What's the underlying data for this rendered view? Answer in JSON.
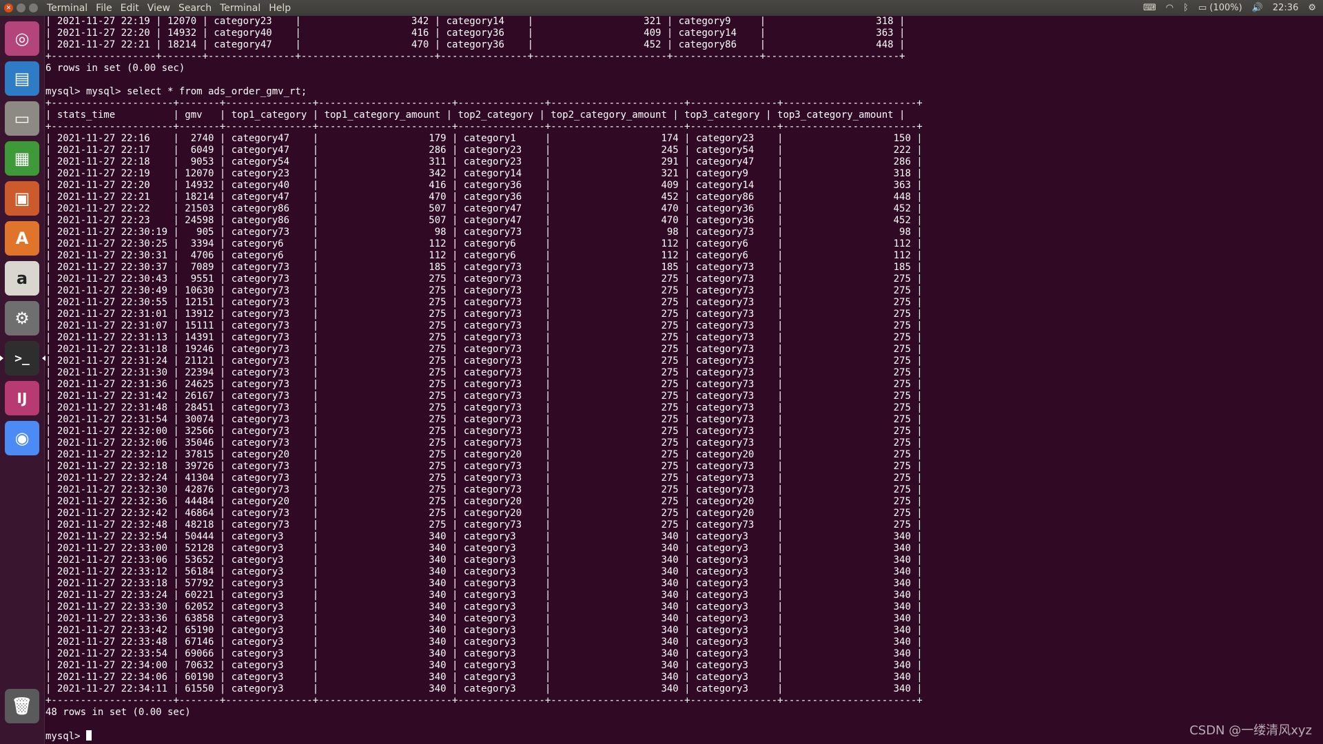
{
  "menubar": {
    "app_name": "Terminal",
    "items": [
      "File",
      "Edit",
      "View",
      "Search",
      "Terminal",
      "Help"
    ],
    "battery": "(100%)",
    "clock": "22:36"
  },
  "launcher": {
    "items": [
      {
        "name": "ubuntu-dash-icon",
        "glyph": "◎",
        "bg": "#b3457a"
      },
      {
        "name": "libreoffice-writer-icon",
        "glyph": "▤",
        "bg": "#2f7cc6"
      },
      {
        "name": "files-icon",
        "glyph": "▭",
        "bg": "#8d8a83"
      },
      {
        "name": "libreoffice-calc-icon",
        "glyph": "▦",
        "bg": "#3e9a38"
      },
      {
        "name": "libreoffice-impress-icon",
        "glyph": "▣",
        "bg": "#cc5a2a"
      },
      {
        "name": "software-center-icon",
        "glyph": "A",
        "bg": "#e0742a"
      },
      {
        "name": "amazon-icon",
        "glyph": "a",
        "bg": "#d9d6d0"
      },
      {
        "name": "system-settings-icon",
        "glyph": "⚙",
        "bg": "#6f6f6f"
      },
      {
        "name": "terminal-icon",
        "glyph": ">_",
        "bg": "#2e2e2e"
      },
      {
        "name": "intellij-idea-icon",
        "glyph": "IJ",
        "bg": "#b83a72"
      },
      {
        "name": "chrome-icon",
        "glyph": "◉",
        "bg": "#4c8bf5"
      },
      {
        "name": "trash-icon",
        "glyph": "🗑",
        "bg": "#5a5a5a"
      }
    ]
  },
  "terminal": {
    "lines": [
      "| 2021-11-27 22:19 | 12070 | category23    |                   342 | category14    |                   321 | category9     |                   318 |",
      "| 2021-11-27 22:20 | 14932 | category40    |                   416 | category36    |                   409 | category14    |                   363 |",
      "| 2021-11-27 22:21 | 18214 | category47    |                   470 | category36    |                   452 | category86    |                   448 |",
      "+------------------+-------+---------------+-----------------------+---------------+-----------------------+---------------+-----------------------+",
      "6 rows in set (0.00 sec)",
      "",
      "mysql> mysql> select * from ads_order_gmv_rt;",
      "+---------------------+-------+---------------+-----------------------+---------------+-----------------------+---------------+-----------------------+",
      "| stats_time          | gmv   | top1_category | top1_category_amount | top2_category | top2_category_amount | top3_category | top3_category_amount |",
      "+---------------------+-------+---------------+-----------------------+---------------+-----------------------+---------------+-----------------------+",
      "| 2021-11-27 22:16    |  2740 | category47    |                   179 | category1     |                   174 | category23    |                   150 |",
      "| 2021-11-27 22:17    |  6049 | category47    |                   286 | category23    |                   245 | category54    |                   222 |",
      "| 2021-11-27 22:18    |  9053 | category54    |                   311 | category23    |                   291 | category47    |                   286 |",
      "| 2021-11-27 22:19    | 12070 | category23    |                   342 | category14    |                   321 | category9     |                   318 |",
      "| 2021-11-27 22:20    | 14932 | category40    |                   416 | category36    |                   409 | category14    |                   363 |",
      "| 2021-11-27 22:21    | 18214 | category47    |                   470 | category36    |                   452 | category86    |                   448 |",
      "| 2021-11-27 22:22    | 21503 | category86    |                   507 | category47    |                   470 | category36    |                   452 |",
      "| 2021-11-27 22:23    | 24598 | category86    |                   507 | category47    |                   470 | category36    |                   452 |",
      "| 2021-11-27 22:30:19 |   905 | category73    |                    98 | category73    |                    98 | category73    |                    98 |",
      "| 2021-11-27 22:30:25 |  3394 | category6     |                   112 | category6     |                   112 | category6     |                   112 |",
      "| 2021-11-27 22:30:31 |  4706 | category6     |                   112 | category6     |                   112 | category6     |                   112 |",
      "| 2021-11-27 22:30:37 |  7089 | category73    |                   185 | category73    |                   185 | category73    |                   185 |",
      "| 2021-11-27 22:30:43 |  9551 | category73    |                   275 | category73    |                   275 | category73    |                   275 |",
      "| 2021-11-27 22:30:49 | 10630 | category73    |                   275 | category73    |                   275 | category73    |                   275 |",
      "| 2021-11-27 22:30:55 | 12151 | category73    |                   275 | category73    |                   275 | category73    |                   275 |",
      "| 2021-11-27 22:31:01 | 13912 | category73    |                   275 | category73    |                   275 | category73    |                   275 |",
      "| 2021-11-27 22:31:07 | 15111 | category73    |                   275 | category73    |                   275 | category73    |                   275 |",
      "| 2021-11-27 22:31:13 | 14391 | category73    |                   275 | category73    |                   275 | category73    |                   275 |",
      "| 2021-11-27 22:31:18 | 19246 | category73    |                   275 | category73    |                   275 | category73    |                   275 |",
      "| 2021-11-27 22:31:24 | 21121 | category73    |                   275 | category73    |                   275 | category73    |                   275 |",
      "| 2021-11-27 22:31:30 | 22394 | category73    |                   275 | category73    |                   275 | category73    |                   275 |",
      "| 2021-11-27 22:31:36 | 24625 | category73    |                   275 | category73    |                   275 | category73    |                   275 |",
      "| 2021-11-27 22:31:42 | 26167 | category73    |                   275 | category73    |                   275 | category73    |                   275 |",
      "| 2021-11-27 22:31:48 | 28451 | category73    |                   275 | category73    |                   275 | category73    |                   275 |",
      "| 2021-11-27 22:31:54 | 30074 | category73    |                   275 | category73    |                   275 | category73    |                   275 |",
      "| 2021-11-27 22:32:00 | 32566 | category73    |                   275 | category73    |                   275 | category73    |                   275 |",
      "| 2021-11-27 22:32:06 | 35046 | category73    |                   275 | category73    |                   275 | category73    |                   275 |",
      "| 2021-11-27 22:32:12 | 37815 | category20    |                   275 | category20    |                   275 | category20    |                   275 |",
      "| 2021-11-27 22:32:18 | 39726 | category73    |                   275 | category73    |                   275 | category73    |                   275 |",
      "| 2021-11-27 22:32:24 | 41304 | category73    |                   275 | category73    |                   275 | category73    |                   275 |",
      "| 2021-11-27 22:32:30 | 42876 | category73    |                   275 | category73    |                   275 | category73    |                   275 |",
      "| 2021-11-27 22:32:36 | 44484 | category20    |                   275 | category20    |                   275 | category20    |                   275 |",
      "| 2021-11-27 22:32:42 | 46864 | category73    |                   275 | category20    |                   275 | category20    |                   275 |",
      "| 2021-11-27 22:32:48 | 48218 | category73    |                   275 | category73    |                   275 | category73    |                   275 |",
      "| 2021-11-27 22:32:54 | 50444 | category3     |                   340 | category3     |                   340 | category3     |                   340 |",
      "| 2021-11-27 22:33:00 | 52128 | category3     |                   340 | category3     |                   340 | category3     |                   340 |",
      "| 2021-11-27 22:33:06 | 53652 | category3     |                   340 | category3     |                   340 | category3     |                   340 |",
      "| 2021-11-27 22:33:12 | 56184 | category3     |                   340 | category3     |                   340 | category3     |                   340 |",
      "| 2021-11-27 22:33:18 | 57792 | category3     |                   340 | category3     |                   340 | category3     |                   340 |",
      "| 2021-11-27 22:33:24 | 60221 | category3     |                   340 | category3     |                   340 | category3     |                   340 |",
      "| 2021-11-27 22:33:30 | 62052 | category3     |                   340 | category3     |                   340 | category3     |                   340 |",
      "| 2021-11-27 22:33:36 | 63858 | category3     |                   340 | category3     |                   340 | category3     |                   340 |",
      "| 2021-11-27 22:33:42 | 65190 | category3     |                   340 | category3     |                   340 | category3     |                   340 |",
      "| 2021-11-27 22:33:48 | 67146 | category3     |                   340 | category3     |                   340 | category3     |                   340 |",
      "| 2021-11-27 22:33:54 | 69066 | category3     |                   340 | category3     |                   340 | category3     |                   340 |",
      "| 2021-11-27 22:34:00 | 70632 | category3     |                   340 | category3     |                   340 | category3     |                   340 |",
      "| 2021-11-27 22:34:06 | 60190 | category3     |                   340 | category3     |                   340 | category3     |                   340 |",
      "| 2021-11-27 22:34:11 | 61550 | category3     |                   340 | category3     |                   340 | category3     |                   340 |",
      "+---------------------+-------+---------------+-----------------------+---------------+-----------------------+---------------+-----------------------+",
      "48 rows in set (0.00 sec)",
      "",
      "mysql> "
    ]
  },
  "watermark": "CSDN @一缕清风xyz"
}
